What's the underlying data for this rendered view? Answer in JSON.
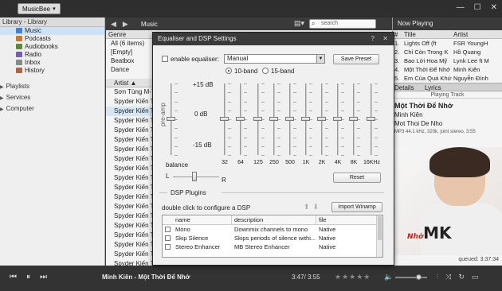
{
  "app": {
    "menu_label": "MusicBee"
  },
  "window_controls": {
    "minimize": "—",
    "maximize": "☐",
    "close": "✕"
  },
  "left": {
    "header": "Library - Library",
    "library_items": [
      {
        "label": "Music",
        "color": "#4a7fc4"
      },
      {
        "label": "Podcasts",
        "color": "#c47a2a"
      },
      {
        "label": "Audiobooks",
        "color": "#5a8a3a"
      },
      {
        "label": "Radio",
        "color": "#7a5ab0"
      },
      {
        "label": "Inbox",
        "color": "#888888"
      },
      {
        "label": "History",
        "color": "#aa6644"
      }
    ],
    "groups": [
      "Playlists",
      "Services",
      "Computer"
    ]
  },
  "middle": {
    "location": "Music",
    "search_placeholder": "search",
    "genre_header": "Genre",
    "genres": [
      "All  (6 items)",
      "[Empty]",
      "Beatbox",
      "Dance"
    ],
    "artist_header": "Artist",
    "artists": [
      "Sơn Tùng M-T",
      "Spyder Kiến T",
      "Spyder Kiến T",
      "Spyder Kiến T",
      "Spyder Kiến T",
      "Spyder Kiến T",
      "Spyder Kiến T",
      "Spyder Kiến T",
      "Spyder Kiến T",
      "Spyder Kiến T",
      "Spyder Kiến T",
      "Spyder Kiến T",
      "Spyder Kiến T",
      "Spyder Kiến T",
      "Spyder Kiến T",
      "Spyder Kiến T",
      "Spyder Kiến T",
      "Spyder Kiến T",
      "Spyder Kiến T",
      "Spyder Kiến T"
    ]
  },
  "right": {
    "header": "Now Playing",
    "col_num": "#",
    "col_title": "Title",
    "col_artist": "Artist",
    "rows": [
      {
        "n": "1.",
        "t": "Lights Off (ft",
        "a": "FSR YoungH"
      },
      {
        "n": "2.",
        "t": "Chỉ Còn Trong K",
        "a": "Hồ Quang"
      },
      {
        "n": "3.",
        "t": "Bao Lời Hoa Mỹ",
        "a": "Lynk Lee ft M"
      },
      {
        "n": "4.",
        "t": "Một Thời Để Nhớ",
        "a": "Minh Kiên"
      },
      {
        "n": "5.",
        "t": "Em Của Quá Khứ",
        "a": "Nguyễn Đình"
      }
    ],
    "tab_details": "Details",
    "tab_lyrics": "Lyrics",
    "playing_track": "Playing Track",
    "track_title": "Một Thời Để Nhớ",
    "track_artist": "Minh Kiên",
    "track_file": "Mot Thoi De Nho",
    "track_meta": "MP3 44.1 kHz, 320k, joint stereo, 3:55",
    "art_mark": "MK",
    "art_script": "Nhớ",
    "queued": "queued: 3:37:34"
  },
  "player": {
    "now_playing": "Minh Kiên - Một Thời Để Nhớ",
    "time": "3:47/ 3:55",
    "rating": "★★★★★",
    "volume": 0.75
  },
  "dialog": {
    "title": "Equaliser and DSP Settings",
    "help": "?",
    "close": "✕",
    "enable_eq_label": "enable equaliser:",
    "preset_value": "Manual",
    "save_preset": "Save Preset",
    "band_10": "10-band",
    "band_15": "15-band",
    "db_plus": "+15 dB",
    "db_zero": "0 dB",
    "db_minus": "-15 dB",
    "preamp": "pre-amp",
    "frequencies": [
      "32",
      "64",
      "125",
      "250",
      "500",
      "1K",
      "2K",
      "4K",
      "8K",
      "16KHz"
    ],
    "balance": "balance",
    "bal_l": "L",
    "bal_r": "R",
    "reset": "Reset",
    "dsp_plugins": "DSP Plugins",
    "configure_hint": "double click to configure a DSP",
    "import_winamp": "Import Winamp",
    "plugin_cols": {
      "name": "name",
      "description": "description",
      "file": "file"
    },
    "plugins": [
      {
        "name": "Mono",
        "description": "Downmix channels to mono",
        "file": "Native"
      },
      {
        "name": "Skip Silence",
        "description": "Skips periods of silence withi...",
        "file": "Native"
      },
      {
        "name": "Stereo Enhancer",
        "description": "MB Stereo Enhancer",
        "file": "Native"
      }
    ]
  }
}
